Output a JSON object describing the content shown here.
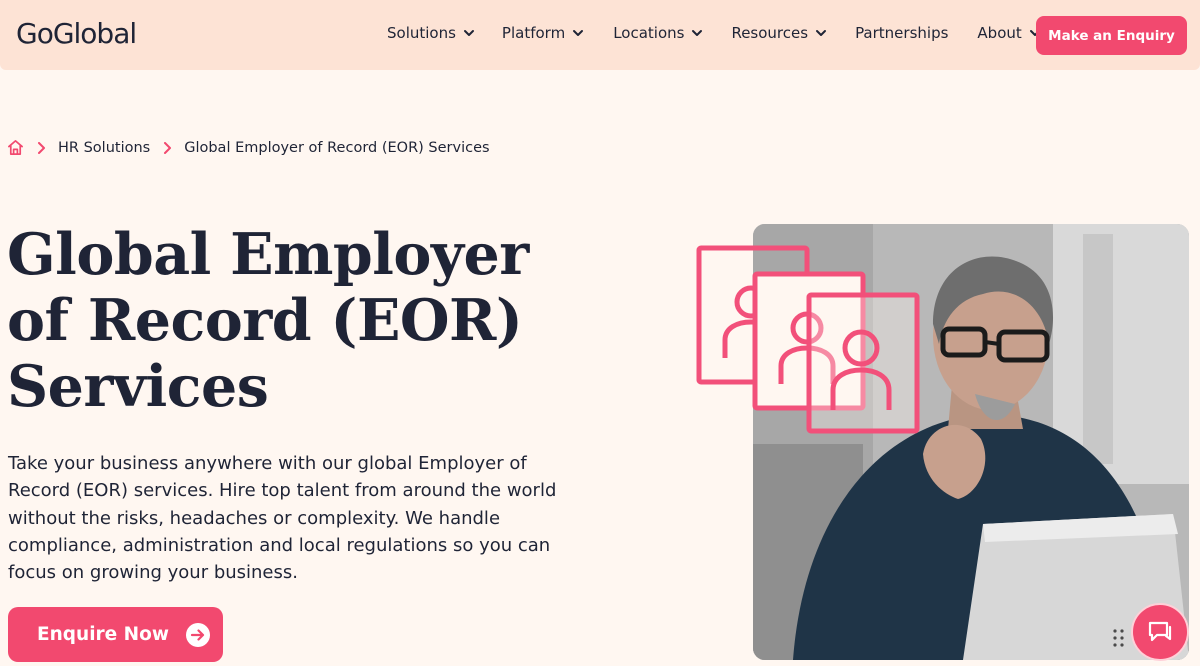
{
  "header": {
    "logo": "GoGlobal",
    "nav": [
      {
        "label": "Solutions",
        "has_dropdown": true
      },
      {
        "label": "Platform",
        "has_dropdown": true
      },
      {
        "label": "Locations",
        "has_dropdown": true
      },
      {
        "label": "Resources",
        "has_dropdown": true
      },
      {
        "label": "Partnerships",
        "has_dropdown": false
      },
      {
        "label": "About",
        "has_dropdown": true
      }
    ],
    "cta_label": "Make an Enquiry"
  },
  "breadcrumb": {
    "home_icon": "home-icon",
    "items": [
      "HR Solutions",
      "Global Employer of Record (EOR) Services"
    ]
  },
  "hero": {
    "title_lines": [
      "Global Employer",
      "of Record (EOR)",
      "Services"
    ],
    "description": "Take your business anywhere with our global Employer of Record (EOR) services. Hire top talent from around the world without the risks, headaches or complexity. We handle compliance, administration and local regulations so you can focus on growing your business.",
    "cta_label": "Enquire Now"
  },
  "icons": {
    "chat": "chat-icon",
    "frames": "profile-cards-illustration"
  },
  "colors": {
    "accent": "#f2496f",
    "header_bg": "#fde3d5",
    "page_bg": "#fff7f1",
    "text": "#1f2436"
  }
}
